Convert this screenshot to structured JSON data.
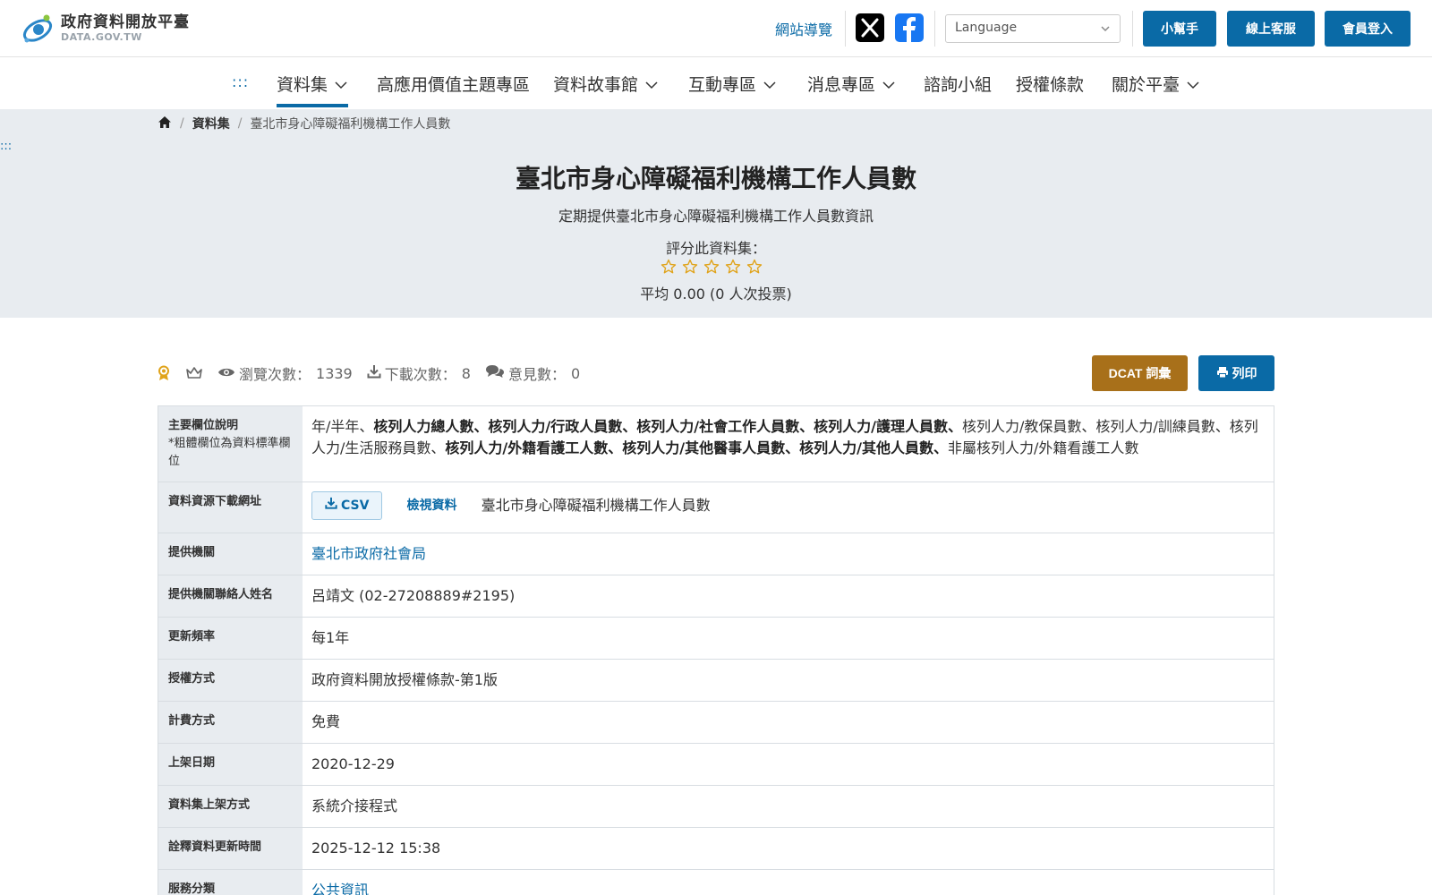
{
  "header": {
    "logo_title": "政府資料開放平臺",
    "logo_sub": "DATA.GOV.TW",
    "sitemap": "網站導覽",
    "language_placeholder": "Language",
    "help_label": "小幫手",
    "service_label": "線上客服",
    "login_label": "會員登入"
  },
  "nav": {
    "dots": ":::",
    "items": [
      {
        "label": "資料集",
        "has_menu": true
      },
      {
        "label": "高應用價值主題專區",
        "has_menu": false
      },
      {
        "label": "資料故事館",
        "has_menu": true
      },
      {
        "label": "互動專區",
        "has_menu": true
      },
      {
        "label": "消息專區",
        "has_menu": true
      },
      {
        "label": "諮詢小組",
        "has_menu": false
      },
      {
        "label": "授權條款",
        "has_menu": false
      },
      {
        "label": "關於平臺",
        "has_menu": true
      }
    ]
  },
  "breadcrumb": {
    "dataset": "資料集",
    "current": "臺北市身心障礙福利機構工作人員數"
  },
  "side_dots": ":::",
  "hero": {
    "title": "臺北市身心障礙福利機構工作人員數",
    "description": "定期提供臺北市身心障礙福利機構工作人員數資訊",
    "rate_label": "評分此資料集：",
    "rating_value": 0,
    "rating_max": 5,
    "rating_summary": "平均 0.00 (0 人次投票)"
  },
  "stats": {
    "views_label": "瀏覽次數：",
    "views": "1339",
    "downloads_label": "下載次數：",
    "downloads": "8",
    "comments_label": "意見數：",
    "comments": "0"
  },
  "actions": {
    "dcat": "DCAT 詞彙",
    "print": "列印"
  },
  "fields": {
    "label": "主要欄位說明",
    "note": "*粗體欄位為資料標準欄位",
    "parts": [
      {
        "text": "年/半年、",
        "bold": false
      },
      {
        "text": "核列人力總人數、",
        "bold": true
      },
      {
        "text": "核列人力/行政人員數、",
        "bold": true
      },
      {
        "text": "核列人力/社會工作人員數、",
        "bold": true
      },
      {
        "text": "核列人力/護理人員數、",
        "bold": true
      },
      {
        "text": "核列人力/教保員數、核列人力/訓練員數、核列人力/生活服務員數、",
        "bold": false
      },
      {
        "text": "核列人力/外籍看護工人數、",
        "bold": true
      },
      {
        "text": "核列人力/其他醫事人員數、",
        "bold": true
      },
      {
        "text": "核列人力/其他人員數、",
        "bold": true
      },
      {
        "text": "非屬核列人力/外籍看護工人數",
        "bold": false
      }
    ]
  },
  "resource": {
    "label": "資料資源下載網址",
    "csv": "CSV",
    "view": "檢視資料",
    "name": "臺北市身心障礙福利機構工作人員數"
  },
  "rows": [
    {
      "label": "提供機關",
      "value": "臺北市政府社會局",
      "link": true
    },
    {
      "label": "提供機關聯絡人姓名",
      "value": "呂靖文 (02-27208889#2195)",
      "link": false
    },
    {
      "label": "更新頻率",
      "value": "每1年",
      "link": false
    },
    {
      "label": "授權方式",
      "value": "政府資料開放授權條款-第1版",
      "link": false
    },
    {
      "label": "計費方式",
      "value": "免費",
      "link": false
    },
    {
      "label": "上架日期",
      "value": "2020-12-29",
      "link": false
    },
    {
      "label": "資料集上架方式",
      "value": "系統介接程式",
      "link": false
    },
    {
      "label": "詮釋資料更新時間",
      "value": "2025-12-12 15:38",
      "link": false
    },
    {
      "label": "服務分類",
      "value": "公共資訊",
      "link": true
    }
  ],
  "colors": {
    "primary": "#0a6aa6",
    "dcat": "#a8701a",
    "hero_bg": "#e8ecf0",
    "star": "#e0a31a"
  }
}
